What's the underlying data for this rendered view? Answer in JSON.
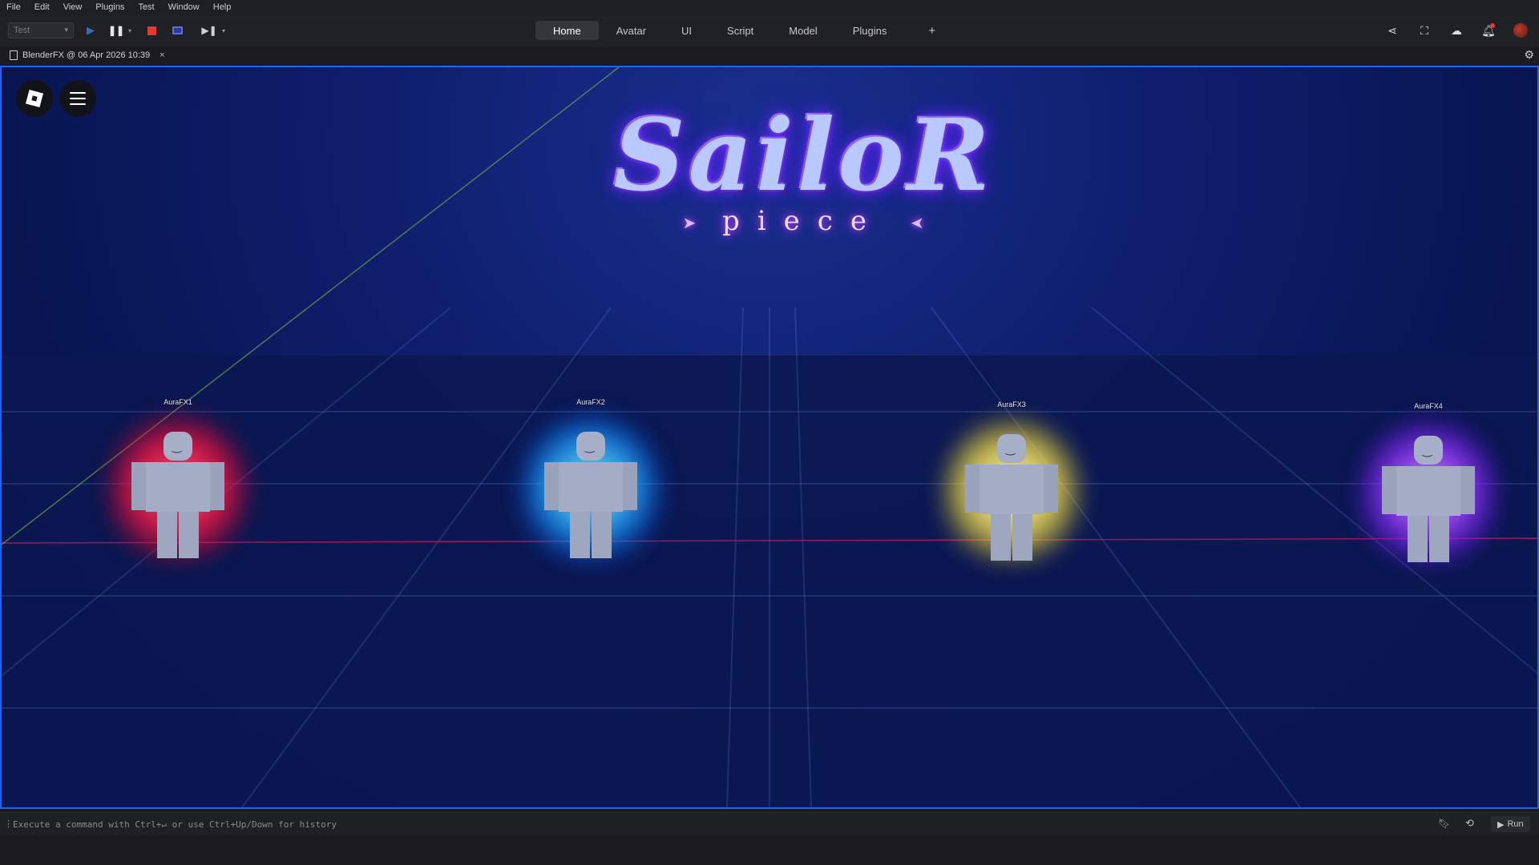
{
  "menu": [
    "File",
    "Edit",
    "View",
    "Plugins",
    "Test",
    "Window",
    "Help"
  ],
  "toolbar": {
    "mode_value": "Test",
    "tabs": [
      {
        "label": "Home",
        "active": true
      },
      {
        "label": "Avatar",
        "active": false
      },
      {
        "label": "UI",
        "active": false
      },
      {
        "label": "Script",
        "active": false
      },
      {
        "label": "Model",
        "active": false
      },
      {
        "label": "Plugins",
        "active": false
      }
    ],
    "add_tab_label": "+",
    "icons": [
      "play-icon",
      "pause-icon",
      "stop-icon",
      "client-server-icon",
      "step-icon",
      "share-icon",
      "collaborate-icon",
      "cloud-icon",
      "bell-icon",
      "avatar"
    ],
    "stop_color": "#e53935",
    "accent_color": "#1565ff"
  },
  "document": {
    "tab_title": "BlenderFX @ 06 Apr 2026 10:39",
    "close_glyph": "×"
  },
  "viewport": {
    "logo_title": "SailoR",
    "logo_subtitle": "piece",
    "characters": [
      {
        "label": "AuraFX1",
        "aura_color": "#ff1e4a"
      },
      {
        "label": "AuraFX2",
        "aura_color": "#2eb6ff"
      },
      {
        "label": "AuraFX3",
        "aura_color": "#ffe95a"
      },
      {
        "label": "AuraFX4",
        "aura_color": "#9d3bff"
      }
    ]
  },
  "command_bar": {
    "placeholder": "Execute a command with Ctrl+↵ or use Ctrl+Up/Down for history",
    "run_label": "Run"
  }
}
